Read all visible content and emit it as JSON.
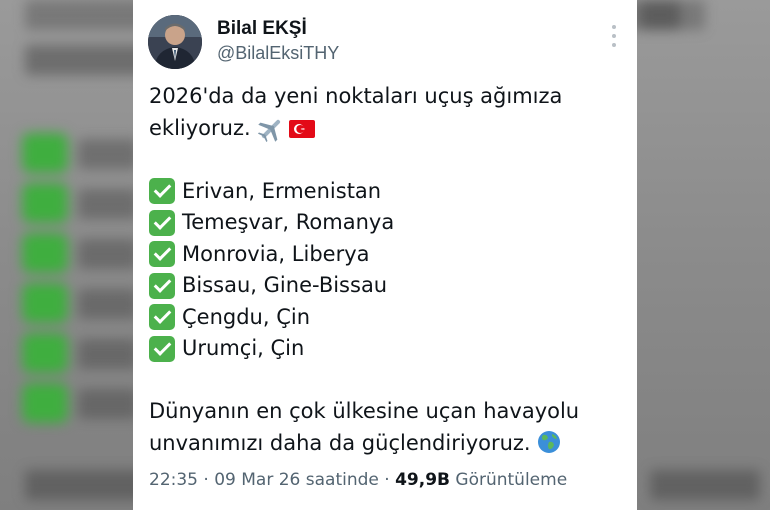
{
  "tweet": {
    "display_name": "Bilal EKŞİ",
    "handle": "@BilalEksiTHY",
    "intro_line_1": "2026'da da yeni noktaları uçuş ağımıza",
    "intro_line_2": "ekliyoruz.",
    "destinations": [
      "Erivan, Ermenistan",
      "Temeşvar, Romanya",
      "Monrovia, Liberya",
      "Bissau, Gine-Bissau",
      "Çengdu, Çin",
      "Urumçi, Çin"
    ],
    "closing_line_1": "Dünyanın en çok ülkesine uçan havayolu",
    "closing_line_2": "unvanımızı daha da güçlendiriyoruz.",
    "time": "22:35",
    "date": "09 Mar 26 saatinde",
    "views_count": "49,9B",
    "views_label": "Görüntüleme",
    "separator": "·"
  },
  "icons": {
    "avatar": "profile-photo",
    "more": "more-options-icon",
    "airplane": "airplane-emoji",
    "flag": "turkey-flag-emoji",
    "check": "check-mark-emoji",
    "globe": "globe-emoji"
  },
  "colors": {
    "text": "#0f1419",
    "secondary": "#536471",
    "check_green": "#4cb14c",
    "flag_red": "#e30a17"
  }
}
